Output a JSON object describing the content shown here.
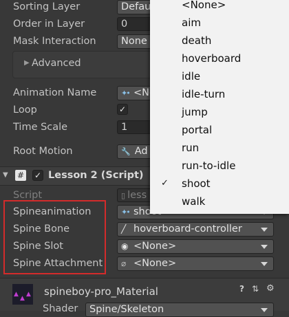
{
  "properties": {
    "sorting_layer": {
      "label": "Sorting Layer",
      "value": "Defau"
    },
    "order_in_layer": {
      "label": "Order in Layer",
      "value": "0"
    },
    "mask_interaction": {
      "label": "Mask Interaction",
      "value": "None"
    },
    "advanced": {
      "label": "Advanced"
    },
    "animation_name": {
      "label": "Animation Name",
      "value": "<No"
    },
    "loop": {
      "label": "Loop",
      "checked": true
    },
    "time_scale": {
      "label": "Time Scale",
      "value": "1"
    },
    "root_motion": {
      "label": "Root Motion",
      "value": "Ad"
    }
  },
  "component": {
    "title": "Lesson 2 (Script)",
    "script_label": "Script",
    "script_value": "less",
    "spine_animation": {
      "label": "Spineanimation",
      "value": "shoot"
    },
    "spine_bone": {
      "label": "Spine Bone",
      "value": "hoverboard-controller"
    },
    "spine_slot": {
      "label": "Spine Slot",
      "value": "<None>"
    },
    "spine_attachment": {
      "label": "Spine Attachment",
      "value": "<None>"
    }
  },
  "material": {
    "name": "spineboy-pro_Material",
    "shader_label": "Shader",
    "shader_value": "Spine/Skeleton"
  },
  "dropdown": {
    "items": [
      "<None>",
      "aim",
      "death",
      "hoverboard",
      "idle",
      "idle-turn",
      "jump",
      "portal",
      "run",
      "run-to-idle",
      "shoot",
      "walk"
    ],
    "selected": "shoot",
    "checkmark": "✓"
  },
  "colors": {
    "background": "#383838",
    "dropdown_bg": "#f2f2f2",
    "highlight": "#d42b2b"
  }
}
